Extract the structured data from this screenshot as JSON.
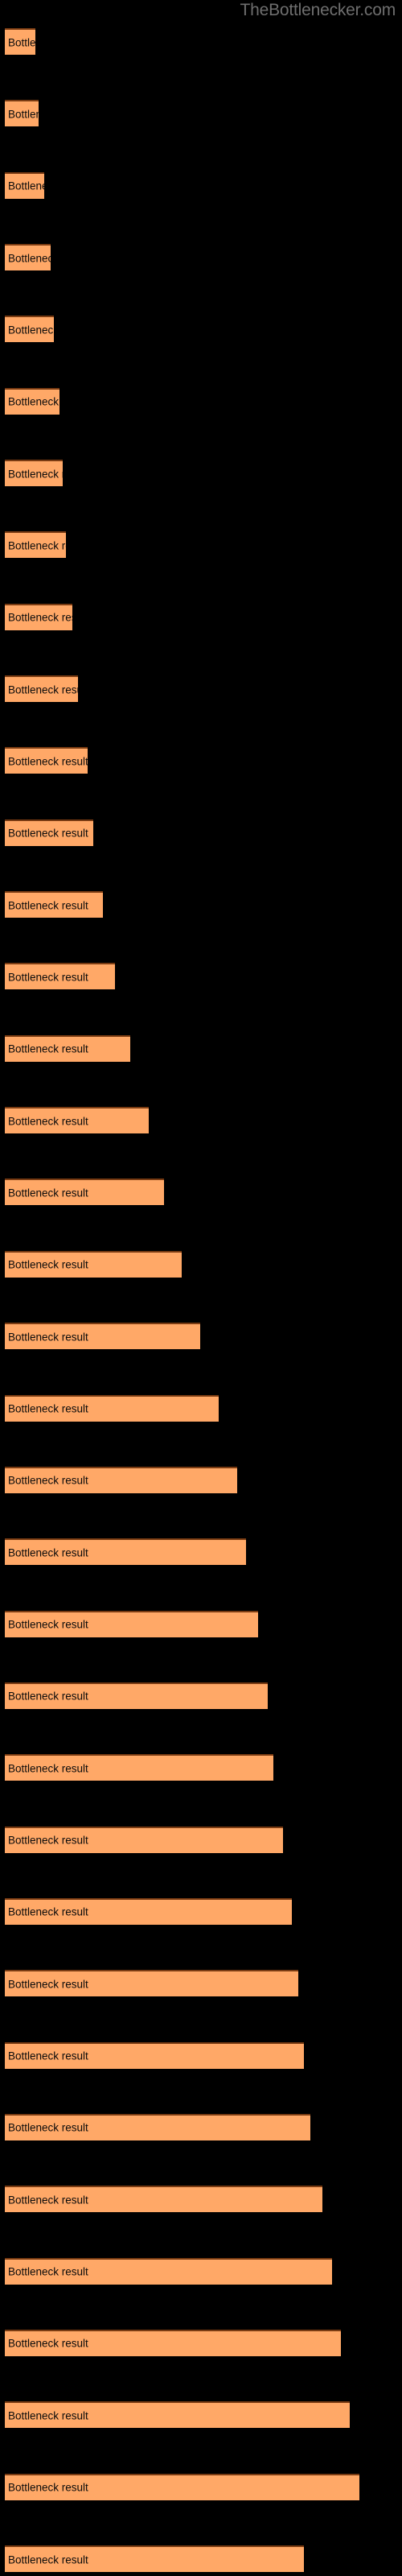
{
  "site": {
    "watermark": "TheBottlenecker.com"
  },
  "chart_data": {
    "type": "bar",
    "orientation": "horizontal",
    "title": "",
    "subtitle": "",
    "xlabel": "",
    "ylabel": "",
    "grid": false,
    "legend": null,
    "axis_visible": false,
    "tick_labels": [],
    "bar_color": "#ffa867",
    "bar_edge_color": "#7a3b12",
    "background_color": "#000000",
    "label_color": "#0b0b0b",
    "watermark_color": "#6e6e6e",
    "xlim": [
      0,
      130
    ],
    "bar_label_text": "Bottleneck result",
    "categories": [
      "Bottleneck result",
      "Bottleneck result",
      "Bottleneck result",
      "Bottleneck result",
      "Bottleneck result",
      "Bottleneck result",
      "Bottleneck result",
      "Bottleneck result",
      "Bottleneck result",
      "Bottleneck result",
      "Bottleneck result",
      "Bottleneck result",
      "Bottleneck result",
      "Bottleneck result",
      "Bottleneck result",
      "Bottleneck result",
      "Bottleneck result",
      "Bottleneck result",
      "Bottleneck result",
      "Bottleneck result",
      "Bottleneck result",
      "Bottleneck result",
      "Bottleneck result",
      "Bottleneck result",
      "Bottleneck result",
      "Bottleneck result",
      "Bottleneck result",
      "Bottleneck result",
      "Bottleneck result",
      "Bottleneck result",
      "Bottleneck result",
      "Bottleneck result",
      "Bottleneck result",
      "Bottleneck result",
      "Bottleneck result",
      "Bottleneck result"
    ],
    "values": [
      10,
      11,
      13,
      15,
      16,
      18,
      19,
      20,
      22,
      24,
      27,
      29,
      32,
      36,
      41,
      47,
      52,
      58,
      64,
      70,
      76,
      79,
      83,
      86,
      88,
      91,
      94,
      96,
      98,
      100,
      104,
      107,
      110,
      113,
      116,
      98
    ]
  }
}
